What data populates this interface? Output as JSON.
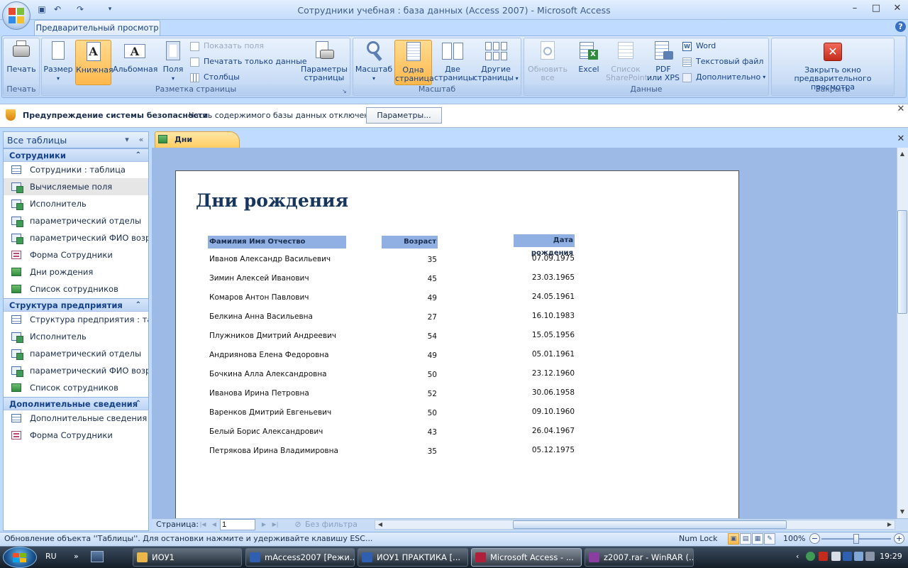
{
  "window": {
    "title": "Сотрудники учебная : база данных (Access 2007) - Microsoft Access",
    "controls": {
      "minimize": "–",
      "maximize": "□",
      "close": "✕"
    }
  },
  "quick_access": {
    "save_icon": "save-icon",
    "undo_icon": "undo-icon",
    "redo_icon": "redo-icon",
    "customize_icon": "chevron-down-icon"
  },
  "ribbon": {
    "active_tab": "Предварительный просмотр",
    "groups": {
      "print": {
        "label": "Печать",
        "print_button": "Печать"
      },
      "page_layout": {
        "label": "Разметка страницы",
        "size_button": "Размер",
        "portrait_button": "Книжная",
        "landscape_button": "Альбомная",
        "margins_button": "Поля",
        "show_margins": "Показать поля",
        "print_data_only": "Печатать только данные",
        "columns": "Столбцы",
        "page_setup_line1": "Параметры",
        "page_setup_line2": "страницы"
      },
      "zoom": {
        "label": "Масштаб",
        "zoom_button": "Масштаб",
        "one_page_line1": "Одна",
        "one_page_line2": "страница",
        "two_pages_line1": "Две",
        "two_pages_line2": "страницы",
        "more_pages_line1": "Другие",
        "more_pages_line2": "страницы"
      },
      "data": {
        "label": "Данные",
        "refresh_line1": "Обновить",
        "refresh_line2": "все",
        "excel": "Excel",
        "sharepoint_line1": "Список",
        "sharepoint_line2": "SharePoint",
        "pdf_line1": "PDF",
        "pdf_line2": "или XPS",
        "word": "Word",
        "text_file": "Текстовый файл",
        "more": "Дополнительно"
      },
      "close_preview": {
        "label": "Закрыть",
        "close_line1": "Закрыть окно",
        "close_line2": "предварительного просмотра"
      }
    }
  },
  "security_bar": {
    "title": "Предупреждение системы безопасности",
    "message": "Часть содержимого базы данных отключено",
    "options_button": "Параметры..."
  },
  "navigation_pane": {
    "title": "Все таблицы",
    "groups": [
      {
        "name": "Сотрудники",
        "items": [
          {
            "label": "Сотрудники : таблица",
            "icon": "table-icon"
          },
          {
            "label": "Вычисляемые поля",
            "icon": "query-icon",
            "selected": true
          },
          {
            "label": "Исполнитель",
            "icon": "query-icon"
          },
          {
            "label": "параметрический отделы",
            "icon": "query-icon"
          },
          {
            "label": "параметрический ФИО возр...",
            "icon": "query-icon"
          },
          {
            "label": "Форма Сотрудники",
            "icon": "form-icon"
          },
          {
            "label": "Дни рождения",
            "icon": "report-icon"
          },
          {
            "label": "Список сотрудников",
            "icon": "report-icon"
          }
        ]
      },
      {
        "name": "Структура предприятия",
        "items": [
          {
            "label": "Структура предприятия : та...",
            "icon": "table-icon"
          },
          {
            "label": "Исполнитель",
            "icon": "query-icon"
          },
          {
            "label": "параметрический отделы",
            "icon": "query-icon"
          },
          {
            "label": "параметрический ФИО возр...",
            "icon": "query-icon"
          },
          {
            "label": "Список сотрудников",
            "icon": "report-icon"
          }
        ]
      },
      {
        "name": "Дополнительные сведения",
        "items": [
          {
            "label": "Дополнительные сведения :...",
            "icon": "table-icon"
          },
          {
            "label": "Форма Сотрудники",
            "icon": "form-icon"
          }
        ]
      }
    ]
  },
  "document": {
    "tab_label": "Дни рождения",
    "report": {
      "title": "Дни рождения",
      "columns": [
        "Фамилия Имя Отчество",
        "Возраст",
        "Дата рождения"
      ],
      "rows": [
        [
          "Иванов Александр Васильевич",
          "35",
          "07.09.1975"
        ],
        [
          "Зимин Алексей Иванович",
          "45",
          "23.03.1965"
        ],
        [
          "Комаров Антон Павлович",
          "49",
          "24.05.1961"
        ],
        [
          "Белкина Анна Васильевна",
          "27",
          "16.10.1983"
        ],
        [
          "Плужников Дмитрий Андреевич",
          "54",
          "15.05.1956"
        ],
        [
          "Андриянова Елена Федоровна",
          "49",
          "05.01.1961"
        ],
        [
          "Бочкина Алла Александровна",
          "50",
          "23.12.1960"
        ],
        [
          "Иванова Ирина Петровна",
          "52",
          "30.06.1958"
        ],
        [
          "Варенков Дмитрий Евгеньевич",
          "50",
          "09.10.1960"
        ],
        [
          "Белый Борис Александрович",
          "43",
          "26.04.1967"
        ],
        [
          "Петрякова Ирина Владимировна",
          "35",
          "05.12.1975"
        ]
      ]
    },
    "page_nav": {
      "label": "Страница:",
      "current_page": "1",
      "filter": "Без фильтра"
    }
  },
  "status_bar": {
    "message": "Обновление объекта ''Таблицы''. Для остановки нажмите и удерживайте клавишу ESC...",
    "num_lock": "Num Lock",
    "zoom": "100%"
  },
  "taskbar": {
    "language": "RU",
    "buttons": [
      {
        "label": "ИОУ1",
        "color": "#e8b64a"
      },
      {
        "label": "mAccess2007 [Режи...",
        "color": "#2e5fb0"
      },
      {
        "label": "ИОУ1 ПРАКТИКА [...",
        "color": "#2e5fb0"
      },
      {
        "label": "Microsoft Access - ...",
        "color": "#b0203a",
        "active": true
      },
      {
        "label": "z2007.rar - WinRAR (...",
        "color": "#8a3fa0"
      }
    ],
    "time": "19:29"
  },
  "colors": {
    "accent": "#15428b",
    "selected_button": "#ffb84c",
    "report_header": "#90b0e4"
  }
}
